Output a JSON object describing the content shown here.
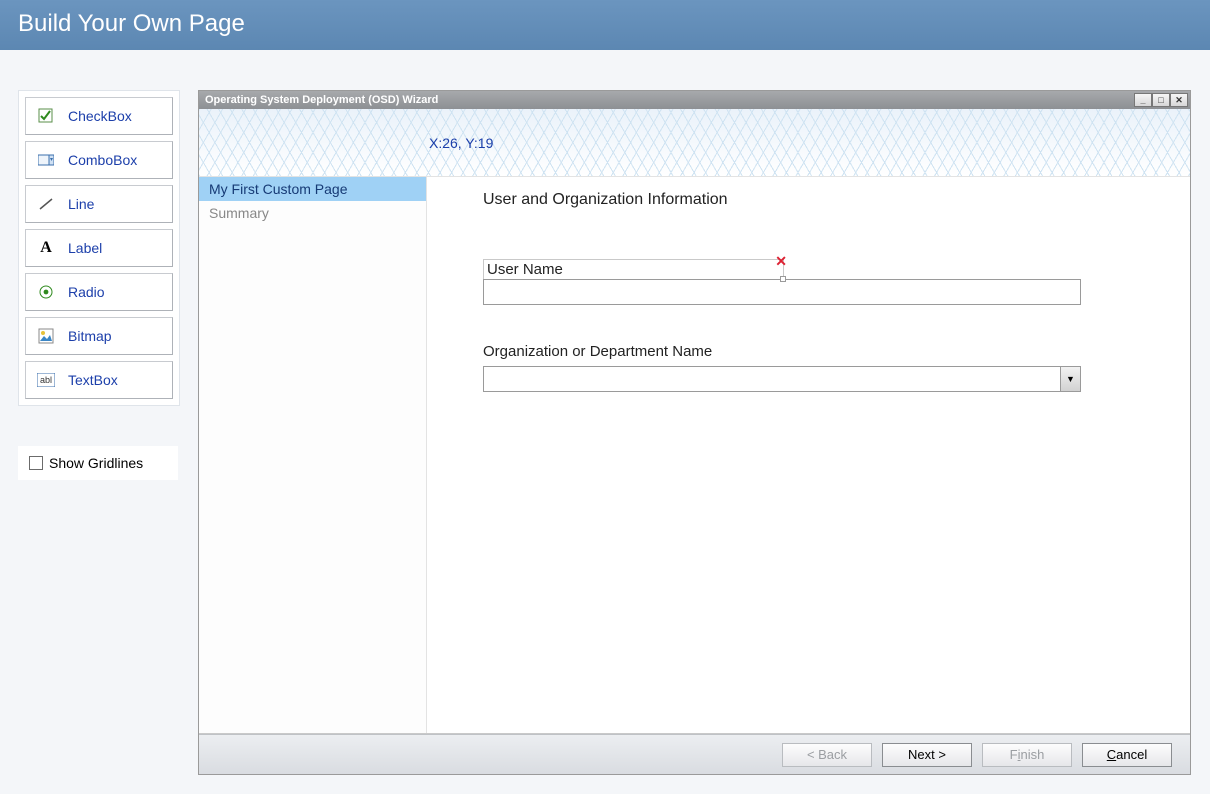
{
  "header": {
    "title": "Build Your Own Page"
  },
  "toolbox": {
    "items": [
      {
        "label": "CheckBox",
        "icon": "checkbox-icon"
      },
      {
        "label": "ComboBox",
        "icon": "combobox-icon"
      },
      {
        "label": "Line",
        "icon": "line-icon"
      },
      {
        "label": "Label",
        "icon": "label-icon"
      },
      {
        "label": "Radio",
        "icon": "radio-icon"
      },
      {
        "label": "Bitmap",
        "icon": "bitmap-icon"
      },
      {
        "label": "TextBox",
        "icon": "textbox-icon"
      }
    ]
  },
  "options": {
    "show_gridlines_label": "Show Gridlines",
    "show_gridlines_checked": false
  },
  "wizard": {
    "title": "Operating System Deployment (OSD) Wizard",
    "coord_text": "X:26, Y:19",
    "steps": [
      {
        "label": "My First Custom Page",
        "active": true
      },
      {
        "label": "Summary",
        "active": false
      }
    ],
    "page": {
      "section_title": "User and Organization Information",
      "username_label": "User Name",
      "username_value": "",
      "org_label": "Organization or Department Name",
      "org_value": ""
    },
    "buttons": {
      "back": "< Back",
      "next": "Next >",
      "finish_pre": "F",
      "finish_ul": "i",
      "finish_post": "nish",
      "cancel_ul": "C",
      "cancel_post": "ancel"
    }
  }
}
